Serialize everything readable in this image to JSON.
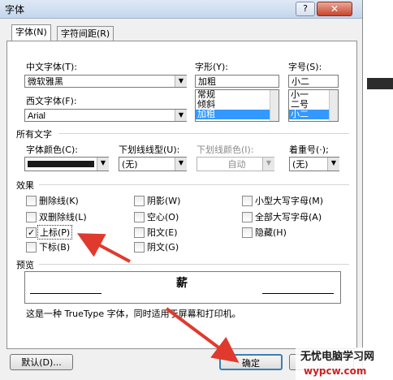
{
  "window": {
    "title": "字体",
    "help_icon": "?",
    "close_icon": "✕"
  },
  "tabs": [
    {
      "label": "字体(N)",
      "active": true
    },
    {
      "label": "字符间距(R)",
      "active": false
    }
  ],
  "fonts": {
    "chinese_font_label": "中文字体(T):",
    "chinese_font_value": "微软雅黑",
    "western_font_label": "西文字体(F):",
    "western_font_value": "Arial",
    "style_label": "字形(Y):",
    "style_value": "加粗",
    "style_options": [
      "常规",
      "倾斜",
      "加粗"
    ],
    "style_selected": "加粗",
    "size_label": "字号(S):",
    "size_value": "小二",
    "size_options": [
      "小一",
      "二号",
      "小二"
    ],
    "size_selected": "小二"
  },
  "all_text": {
    "section_label": "所有文字",
    "font_color_label": "字体颜色(C):",
    "font_color_value": "#1a1a1a",
    "underline_style_label": "下划线线型(U):",
    "underline_style_value": "(无)",
    "underline_color_label": "下划线颜色(I):",
    "underline_color_value": "自动",
    "emphasis_label": "着重号(·);",
    "emphasis_value": "(无)"
  },
  "effects": {
    "section_label": "效果",
    "items": [
      {
        "label": "删除线(K)",
        "checked": false
      },
      {
        "label": "双删除线(L)",
        "checked": false
      },
      {
        "label": "上标(P)",
        "checked": true
      },
      {
        "label": "下标(B)",
        "checked": false
      },
      {
        "label": "阴影(W)",
        "checked": false
      },
      {
        "label": "空心(O)",
        "checked": false
      },
      {
        "label": "阳文(E)",
        "checked": false
      },
      {
        "label": "阴文(G)",
        "checked": false
      },
      {
        "label": "小型大写字母(M)",
        "checked": false
      },
      {
        "label": "全部大写字母(A)",
        "checked": false
      },
      {
        "label": "隐藏(H)",
        "checked": false
      }
    ]
  },
  "preview": {
    "section_label": "预览",
    "sample_text": "薪",
    "description": "这是一种 TrueType 字体，同时适用于屏幕和打印机。"
  },
  "buttons": {
    "default_label": "默认(D)...",
    "ok_label": "确定"
  },
  "watermark": {
    "line1": "无忧电脑学习网",
    "line2": "wypcw.com"
  },
  "colors": {
    "arrow": "#e03a2e",
    "selection": "#3399ff"
  }
}
